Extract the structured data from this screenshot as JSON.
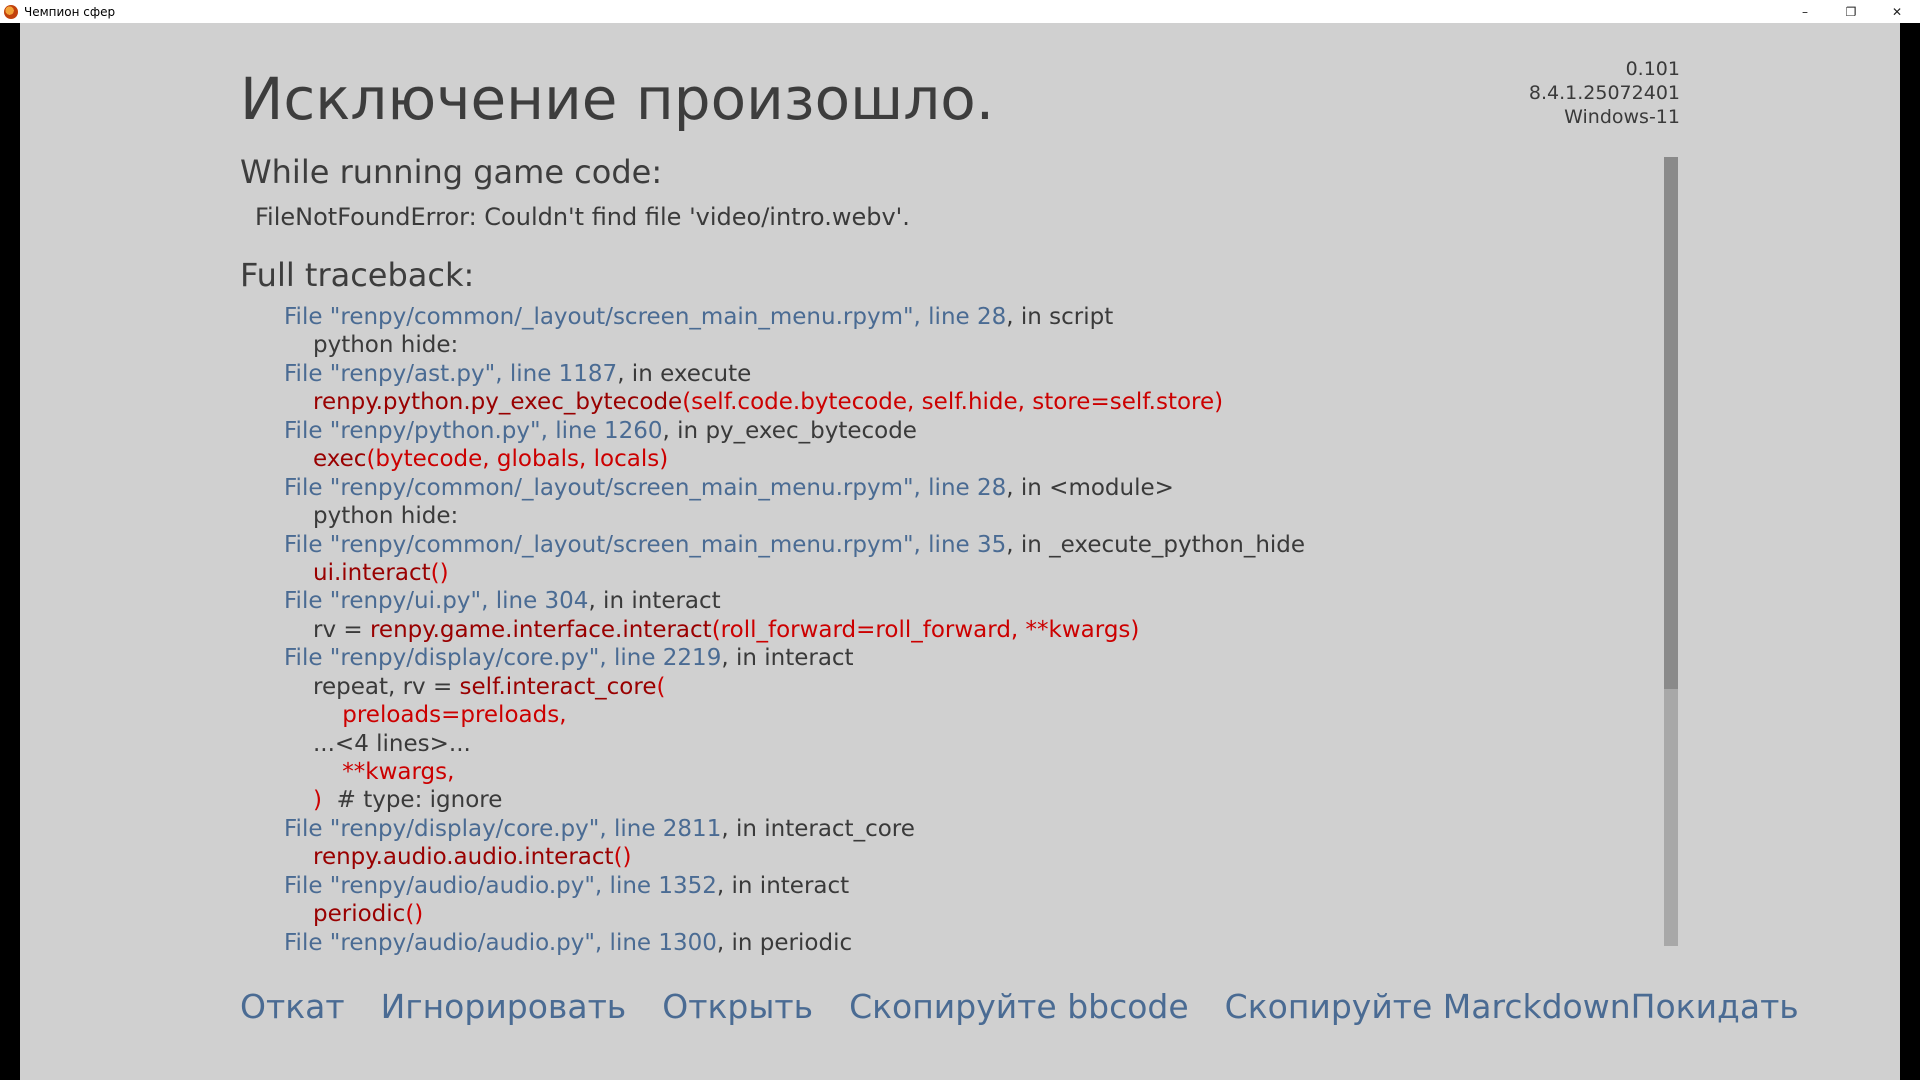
{
  "window": {
    "title": "Чемпион сфер",
    "controls": {
      "minimize": "–",
      "restore": "❐",
      "close": "✕"
    }
  },
  "version": [
    "0.101",
    "8.4.1.25072401",
    "Windows-11"
  ],
  "heading": "Исключение произошло.",
  "while_running": {
    "label": "While running game code:",
    "message": "FileNotFoundError: Couldn't find file 'video/intro.webv'."
  },
  "full_traceback": {
    "label": "Full traceback:",
    "lines": [
      {
        "indent": 1,
        "parts": [
          {
            "t": "link",
            "v": "File \"renpy/common/_layout/screen_main_menu.rpym\", line 28"
          },
          {
            "t": "plain",
            "v": ", in script"
          }
        ]
      },
      {
        "indent": 2,
        "parts": [
          {
            "t": "plain",
            "v": "python hide:"
          }
        ]
      },
      {
        "indent": 1,
        "parts": [
          {
            "t": "link",
            "v": "File \"renpy/ast.py\", line 1187"
          },
          {
            "t": "plain",
            "v": ", in execute"
          }
        ]
      },
      {
        "indent": 2,
        "parts": [
          {
            "t": "fn",
            "v": "renpy.python.py_exec_bytecode"
          },
          {
            "t": "arg",
            "v": "(self.code.bytecode, self.hide, store=self.store)"
          }
        ]
      },
      {
        "indent": 1,
        "parts": [
          {
            "t": "link",
            "v": "File \"renpy/python.py\", line 1260"
          },
          {
            "t": "plain",
            "v": ", in py_exec_bytecode"
          }
        ]
      },
      {
        "indent": 2,
        "parts": [
          {
            "t": "fn",
            "v": "exec"
          },
          {
            "t": "arg",
            "v": "(bytecode, globals, locals)"
          }
        ]
      },
      {
        "indent": 1,
        "parts": [
          {
            "t": "link",
            "v": "File \"renpy/common/_layout/screen_main_menu.rpym\", line 28"
          },
          {
            "t": "plain",
            "v": ", in <module>"
          }
        ]
      },
      {
        "indent": 2,
        "parts": [
          {
            "t": "plain",
            "v": "python hide:"
          }
        ]
      },
      {
        "indent": 1,
        "parts": [
          {
            "t": "link",
            "v": "File \"renpy/common/_layout/screen_main_menu.rpym\", line 35"
          },
          {
            "t": "plain",
            "v": ", in _execute_python_hide"
          }
        ]
      },
      {
        "indent": 2,
        "parts": [
          {
            "t": "fn",
            "v": "ui.interact"
          },
          {
            "t": "arg",
            "v": "()"
          }
        ]
      },
      {
        "indent": 1,
        "parts": [
          {
            "t": "link",
            "v": "File \"renpy/ui.py\", line 304"
          },
          {
            "t": "plain",
            "v": ", in interact"
          }
        ]
      },
      {
        "indent": 2,
        "parts": [
          {
            "t": "plain",
            "v": "rv = "
          },
          {
            "t": "fn",
            "v": "renpy.game.interface.interact"
          },
          {
            "t": "arg",
            "v": "(roll_forward=roll_forward, **kwargs)"
          }
        ]
      },
      {
        "indent": 1,
        "parts": [
          {
            "t": "link",
            "v": "File \"renpy/display/core.py\", line 2219"
          },
          {
            "t": "plain",
            "v": ", in interact"
          }
        ]
      },
      {
        "indent": 2,
        "parts": [
          {
            "t": "plain",
            "v": "repeat, rv = "
          },
          {
            "t": "fn",
            "v": "self.interact_core"
          },
          {
            "t": "arg",
            "v": "("
          }
        ]
      },
      {
        "indent": 2,
        "parts": [
          {
            "t": "arg",
            "v": "    preloads=preloads,"
          }
        ]
      },
      {
        "indent": 2,
        "parts": [
          {
            "t": "plain",
            "v": "...<4 lines>..."
          }
        ]
      },
      {
        "indent": 2,
        "parts": [
          {
            "t": "arg",
            "v": "    **kwargs,"
          }
        ]
      },
      {
        "indent": 2,
        "parts": [
          {
            "t": "arg",
            "v": ")"
          },
          {
            "t": "plain",
            "v": "  # type: ignore"
          }
        ]
      },
      {
        "indent": 1,
        "parts": [
          {
            "t": "link",
            "v": "File \"renpy/display/core.py\", line 2811"
          },
          {
            "t": "plain",
            "v": ", in interact_core"
          }
        ]
      },
      {
        "indent": 2,
        "parts": [
          {
            "t": "fn",
            "v": "renpy.audio.audio.interact"
          },
          {
            "t": "arg",
            "v": "()"
          }
        ]
      },
      {
        "indent": 1,
        "parts": [
          {
            "t": "link",
            "v": "File \"renpy/audio/audio.py\", line 1352"
          },
          {
            "t": "plain",
            "v": ", in interact"
          }
        ]
      },
      {
        "indent": 2,
        "parts": [
          {
            "t": "fn",
            "v": "periodic"
          },
          {
            "t": "arg",
            "v": "()"
          }
        ]
      },
      {
        "indent": 1,
        "parts": [
          {
            "t": "link",
            "v": "File \"renpy/audio/audio.py\", line 1300"
          },
          {
            "t": "plain",
            "v": ", in periodic"
          }
        ]
      }
    ]
  },
  "buttons": {
    "rollback": "Откат",
    "ignore": "Игнорировать",
    "open": "Открыть",
    "copy_bbcode": "Скопируйте bbcode",
    "copy_markdown": "Скопируйте Marckdown",
    "quit": "Покидать"
  },
  "colors": {
    "background": "#d0d0d0",
    "link": "#4a6b93",
    "function": "#990000",
    "argument": "#cc0000",
    "text": "#3a3a3a"
  },
  "scroll_position": 0.0
}
